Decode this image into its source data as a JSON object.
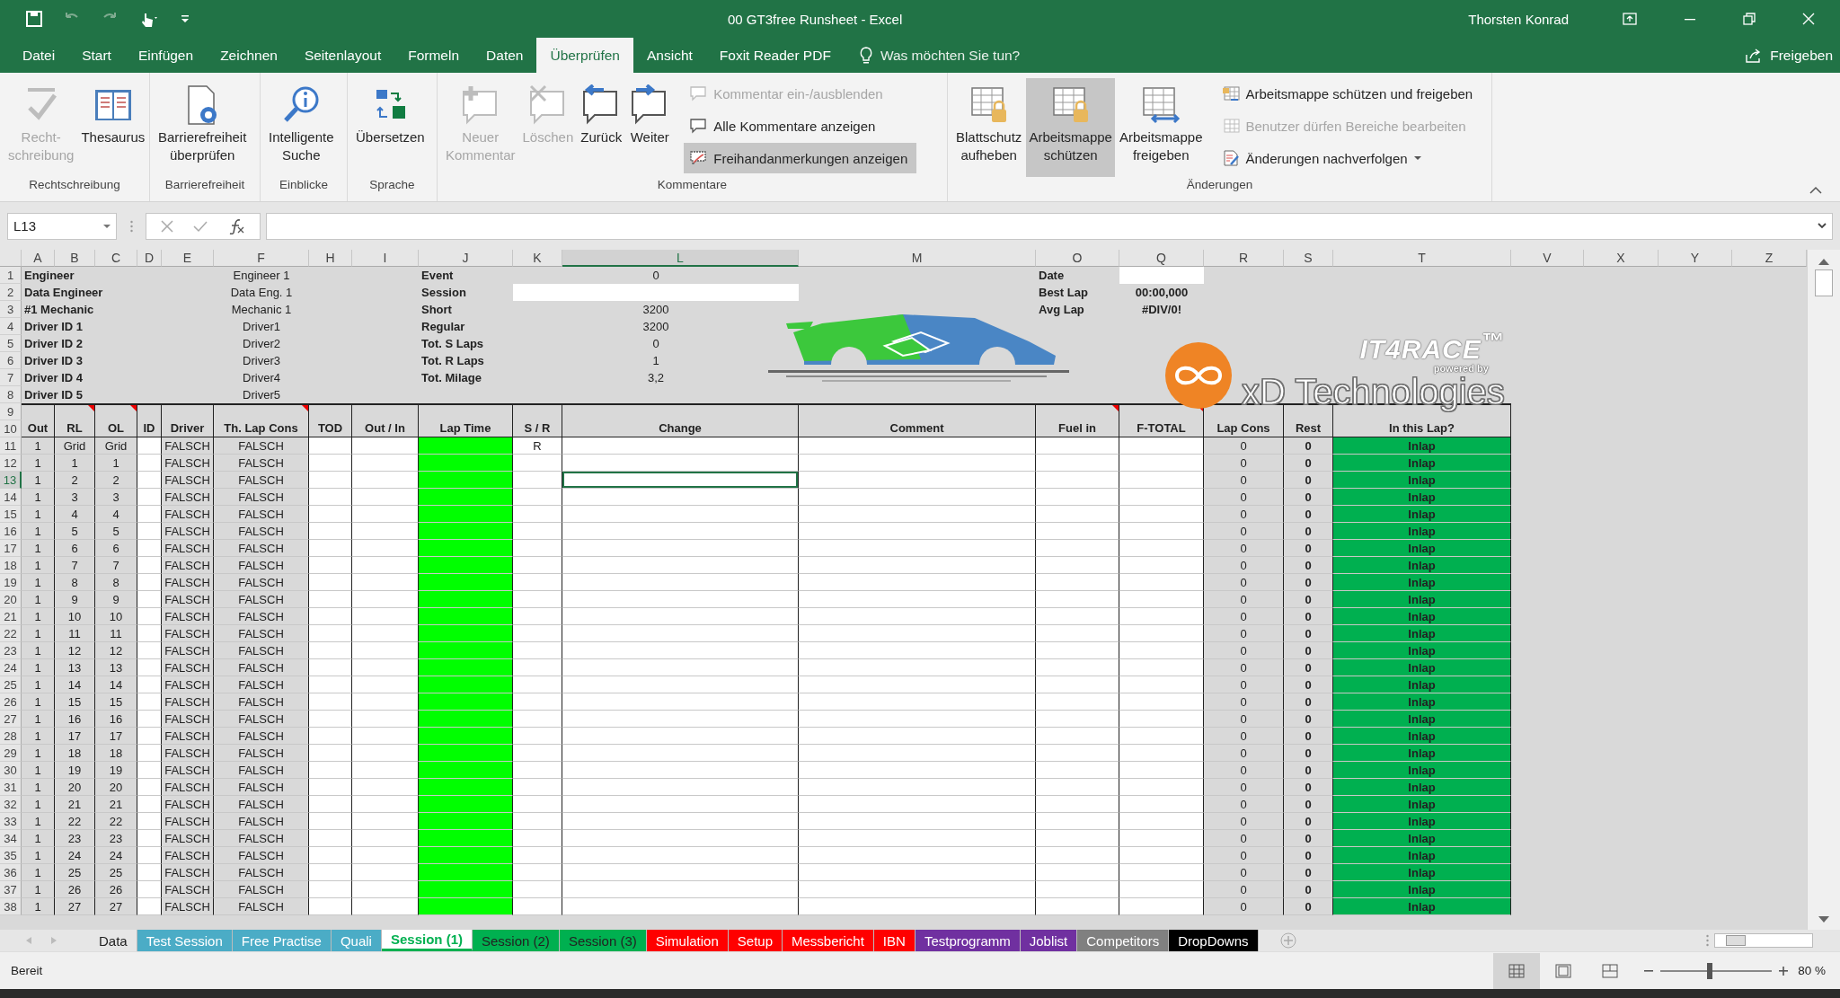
{
  "title_bar": {
    "title": "00 GT3free Runsheet  -  Excel",
    "user": "Thorsten Konrad",
    "quick_access": [
      {
        "disabled": false
      },
      {
        "disabled": true
      },
      {
        "disabled": true
      },
      {
        "disabled": false
      },
      {
        "disabled": false
      }
    ]
  },
  "menu_tabs": [
    {
      "label": "Datei",
      "selected": false
    },
    {
      "label": "Start",
      "selected": false
    },
    {
      "label": "Einfügen",
      "selected": false
    },
    {
      "label": "Zeichnen",
      "selected": false
    },
    {
      "label": "Seitenlayout",
      "selected": false
    },
    {
      "label": "Formeln",
      "selected": false
    },
    {
      "label": "Daten",
      "selected": false
    },
    {
      "label": "Überprüfen",
      "selected": true
    },
    {
      "label": "Ansicht",
      "selected": false
    },
    {
      "label": "Foxit Reader PDF",
      "selected": false
    }
  ],
  "tell_me": {
    "placeholder": "Was möchten Sie tun?"
  },
  "share_button": "Freigeben",
  "ribbon": {
    "groups": [
      {
        "label": "Rechtschreibung",
        "items": [
          {
            "kind": "large",
            "label": "Recht-\nschreibung",
            "disabled": true,
            "pressed": false
          },
          {
            "kind": "large",
            "label": "Thesaurus",
            "disabled": false,
            "pressed": false
          }
        ]
      },
      {
        "label": "Barrierefreiheit",
        "items": [
          {
            "kind": "large",
            "label": "Barrierefreiheit\nüberprüfen",
            "disabled": false,
            "pressed": false
          }
        ]
      },
      {
        "label": "Einblicke",
        "items": [
          {
            "kind": "large",
            "label": "Intelligente\nSuche",
            "disabled": false,
            "pressed": false
          }
        ]
      },
      {
        "label": "Sprache",
        "items": [
          {
            "kind": "large",
            "label": "Übersetzen",
            "disabled": false,
            "pressed": false
          }
        ]
      },
      {
        "label": "Kommentare",
        "items": [
          {
            "kind": "large",
            "label": "Neuer\nKommentar",
            "disabled": true,
            "pressed": false
          },
          {
            "kind": "large",
            "label": "Löschen",
            "disabled": true,
            "pressed": false
          },
          {
            "kind": "large",
            "label": "Zurück",
            "disabled": false,
            "pressed": false
          },
          {
            "kind": "large",
            "label": "Weiter",
            "disabled": false,
            "pressed": false
          },
          {
            "kind": "small",
            "label": "Kommentar ein-/ausblenden",
            "disabled": true,
            "pressed": false
          },
          {
            "kind": "small",
            "label": "Alle Kommentare anzeigen",
            "disabled": false,
            "pressed": false
          },
          {
            "kind": "small",
            "label": "Freihandanmerkungen anzeigen",
            "disabled": false,
            "pressed": true
          }
        ]
      },
      {
        "label": "Änderungen",
        "items": [
          {
            "kind": "large",
            "label": "Blattschutz\naufheben",
            "disabled": false,
            "pressed": false
          },
          {
            "kind": "large",
            "label": "Arbeitsmappe\nschützen",
            "disabled": false,
            "pressed": true
          },
          {
            "kind": "large",
            "label": "Arbeitsmappe\nfreigeben",
            "disabled": false,
            "pressed": false
          },
          {
            "kind": "small",
            "label": "Arbeitsmappe schützen und freigeben",
            "disabled": false,
            "pressed": false
          },
          {
            "kind": "small",
            "label": "Benutzer dürfen Bereiche bearbeiten",
            "disabled": true,
            "pressed": false
          },
          {
            "kind": "dropdown",
            "label": "Änderungen nachverfolgen",
            "disabled": false,
            "pressed": false
          }
        ]
      }
    ]
  },
  "formula_bar": {
    "name_box": "L13"
  },
  "sheet": {
    "column_letters": [
      {
        "letter": "A",
        "selected": false
      },
      {
        "letter": "B",
        "selected": false
      },
      {
        "letter": "C",
        "selected": false
      },
      {
        "letter": "D",
        "selected": false
      },
      {
        "letter": "E",
        "selected": false
      },
      {
        "letter": "F",
        "selected": false
      },
      {
        "letter": "H",
        "selected": false
      },
      {
        "letter": "I",
        "selected": false
      },
      {
        "letter": "J",
        "selected": false
      },
      {
        "letter": "K",
        "selected": false
      },
      {
        "letter": "L",
        "selected": true
      },
      {
        "letter": "M",
        "selected": false
      },
      {
        "letter": "O",
        "selected": false
      },
      {
        "letter": "Q",
        "selected": false
      },
      {
        "letter": "R",
        "selected": false
      },
      {
        "letter": "S",
        "selected": false
      },
      {
        "letter": "T",
        "selected": false
      },
      {
        "letter": "V",
        "selected": false
      },
      {
        "letter": "X",
        "selected": false
      },
      {
        "letter": "Y",
        "selected": false
      },
      {
        "letter": "Z",
        "selected": false
      }
    ],
    "info_rows": [
      {
        "row": "1",
        "crew_label": "Engineer",
        "crew_value": "Engineer 1",
        "session_label": "Event",
        "session_value": "0",
        "lap_label": "Date",
        "lap_field": true
      },
      {
        "row": "2",
        "crew_label": "Data Engineer",
        "crew_value": "Data Eng. 1",
        "session_label": "Session",
        "session_field": true,
        "lap_label": "Best Lap",
        "lap_value": "00:00,000"
      },
      {
        "row": "3",
        "crew_label": "#1 Mechanic",
        "crew_value": "Mechanic 1",
        "session_label": "Short",
        "session_value": "3200",
        "lap_label": "Avg Lap",
        "lap_value": "#DIV/0!"
      },
      {
        "row": "4",
        "crew_label": "Driver ID 1",
        "crew_value": "Driver1",
        "session_label": "Regular",
        "session_value": "3200"
      },
      {
        "row": "5",
        "crew_label": "Driver ID 2",
        "crew_value": "Driver2",
        "session_label": "Tot. S Laps",
        "session_value": "0"
      },
      {
        "row": "6",
        "crew_label": "Driver ID 3",
        "crew_value": "Driver3",
        "session_label": "Tot. R Laps",
        "session_value": "1"
      },
      {
        "row": "7",
        "crew_label": "Driver ID 4",
        "crew_value": "Driver4",
        "session_label": "Tot. Milage",
        "session_value": "3,2"
      },
      {
        "row": "8",
        "crew_label": "Driver ID 5",
        "crew_value": "Driver5"
      },
      {
        "row": "9"
      }
    ],
    "logo": {
      "brand": "IT4RACE$^{™}$",
      "tagline": "powered by",
      "company": "xD Technologies"
    },
    "table": {
      "header_rows": [
        "10"
      ],
      "columns": [
        {
          "label": "Out",
          "comment": false,
          "color": "#d9d9d9"
        },
        {
          "label": "RL",
          "comment": true,
          "color": "#d9d9d9"
        },
        {
          "label": "OL",
          "comment": true,
          "color": "#d9d9d9"
        },
        {
          "label": "ID",
          "comment": false,
          "color": "#ffffff"
        },
        {
          "label": "Driver",
          "comment": false,
          "color": "#d9d9d9"
        },
        {
          "label": "Th. Lap Cons",
          "comment": true,
          "color": "#d9d9d9"
        },
        {
          "label": "TOD",
          "comment": false,
          "color": "#ffffff"
        },
        {
          "label": "Out / In",
          "comment": false,
          "color": "#ffffff"
        },
        {
          "label": "Lap Time",
          "comment": false,
          "color": "#00ff00"
        },
        {
          "label": "S / R",
          "comment": false,
          "color": "#ffffff"
        },
        {
          "label": "Change",
          "comment": false,
          "color": "#ffffff"
        },
        {
          "label": "Comment",
          "comment": false,
          "color": "#ffffff"
        },
        {
          "label": "Fuel in",
          "comment": true,
          "color": "#ffffff"
        },
        {
          "label": "F-TOTAL",
          "comment": true,
          "color": "#ffffff"
        },
        {
          "label": "Lap Cons",
          "comment": false,
          "color": "#d9d9d9"
        },
        {
          "label": "Rest",
          "comment": false,
          "color": "#d9d9d9"
        },
        {
          "label": "In this Lap?",
          "comment": false,
          "color": "#00b050"
        }
      ],
      "rows": [
        {
          "row": "11",
          "selected": false,
          "out": "1",
          "rl": "Grid",
          "ol": "Grid",
          "driver": "FALSCH",
          "th_lap_cons": "FALSCH",
          "s_r": "R",
          "lap_cons": "0",
          "rest": "0",
          "in_this_lap": "Inlap"
        },
        {
          "row": "12",
          "selected": false,
          "out": "1",
          "rl": "1",
          "ol": "1",
          "driver": "FALSCH",
          "th_lap_cons": "FALSCH",
          "lap_cons": "0",
          "rest": "0",
          "in_this_lap": "Inlap"
        },
        {
          "row": "13",
          "selected": true,
          "out": "1",
          "rl": "2",
          "ol": "2",
          "driver": "FALSCH",
          "th_lap_cons": "FALSCH",
          "lap_cons": "0",
          "rest": "0",
          "in_this_lap": "Inlap"
        },
        {
          "row": "14",
          "selected": false,
          "out": "1",
          "rl": "3",
          "ol": "3",
          "driver": "FALSCH",
          "th_lap_cons": "FALSCH",
          "lap_cons": "0",
          "rest": "0",
          "in_this_lap": "Inlap"
        },
        {
          "row": "15",
          "selected": false,
          "out": "1",
          "rl": "4",
          "ol": "4",
          "driver": "FALSCH",
          "th_lap_cons": "FALSCH",
          "lap_cons": "0",
          "rest": "0",
          "in_this_lap": "Inlap"
        },
        {
          "row": "16",
          "selected": false,
          "out": "1",
          "rl": "5",
          "ol": "5",
          "driver": "FALSCH",
          "th_lap_cons": "FALSCH",
          "lap_cons": "0",
          "rest": "0",
          "in_this_lap": "Inlap"
        },
        {
          "row": "17",
          "selected": false,
          "out": "1",
          "rl": "6",
          "ol": "6",
          "driver": "FALSCH",
          "th_lap_cons": "FALSCH",
          "lap_cons": "0",
          "rest": "0",
          "in_this_lap": "Inlap"
        },
        {
          "row": "18",
          "selected": false,
          "out": "1",
          "rl": "7",
          "ol": "7",
          "driver": "FALSCH",
          "th_lap_cons": "FALSCH",
          "lap_cons": "0",
          "rest": "0",
          "in_this_lap": "Inlap"
        },
        {
          "row": "19",
          "selected": false,
          "out": "1",
          "rl": "8",
          "ol": "8",
          "driver": "FALSCH",
          "th_lap_cons": "FALSCH",
          "lap_cons": "0",
          "rest": "0",
          "in_this_lap": "Inlap"
        },
        {
          "row": "20",
          "selected": false,
          "out": "1",
          "rl": "9",
          "ol": "9",
          "driver": "FALSCH",
          "th_lap_cons": "FALSCH",
          "lap_cons": "0",
          "rest": "0",
          "in_this_lap": "Inlap"
        },
        {
          "row": "21",
          "selected": false,
          "out": "1",
          "rl": "10",
          "ol": "10",
          "driver": "FALSCH",
          "th_lap_cons": "FALSCH",
          "lap_cons": "0",
          "rest": "0",
          "in_this_lap": "Inlap"
        },
        {
          "row": "22",
          "selected": false,
          "out": "1",
          "rl": "11",
          "ol": "11",
          "driver": "FALSCH",
          "th_lap_cons": "FALSCH",
          "lap_cons": "0",
          "rest": "0",
          "in_this_lap": "Inlap"
        },
        {
          "row": "23",
          "selected": false,
          "out": "1",
          "rl": "12",
          "ol": "12",
          "driver": "FALSCH",
          "th_lap_cons": "FALSCH",
          "lap_cons": "0",
          "rest": "0",
          "in_this_lap": "Inlap"
        },
        {
          "row": "24",
          "selected": false,
          "out": "1",
          "rl": "13",
          "ol": "13",
          "driver": "FALSCH",
          "th_lap_cons": "FALSCH",
          "lap_cons": "0",
          "rest": "0",
          "in_this_lap": "Inlap"
        },
        {
          "row": "25",
          "selected": false,
          "out": "1",
          "rl": "14",
          "ol": "14",
          "driver": "FALSCH",
          "th_lap_cons": "FALSCH",
          "lap_cons": "0",
          "rest": "0",
          "in_this_lap": "Inlap"
        },
        {
          "row": "26",
          "selected": false,
          "out": "1",
          "rl": "15",
          "ol": "15",
          "driver": "FALSCH",
          "th_lap_cons": "FALSCH",
          "lap_cons": "0",
          "rest": "0",
          "in_this_lap": "Inlap"
        },
        {
          "row": "27",
          "selected": false,
          "out": "1",
          "rl": "16",
          "ol": "16",
          "driver": "FALSCH",
          "th_lap_cons": "FALSCH",
          "lap_cons": "0",
          "rest": "0",
          "in_this_lap": "Inlap"
        },
        {
          "row": "28",
          "selected": false,
          "out": "1",
          "rl": "17",
          "ol": "17",
          "driver": "FALSCH",
          "th_lap_cons": "FALSCH",
          "lap_cons": "0",
          "rest": "0",
          "in_this_lap": "Inlap"
        },
        {
          "row": "29",
          "selected": false,
          "out": "1",
          "rl": "18",
          "ol": "18",
          "driver": "FALSCH",
          "th_lap_cons": "FALSCH",
          "lap_cons": "0",
          "rest": "0",
          "in_this_lap": "Inlap"
        },
        {
          "row": "30",
          "selected": false,
          "out": "1",
          "rl": "19",
          "ol": "19",
          "driver": "FALSCH",
          "th_lap_cons": "FALSCH",
          "lap_cons": "0",
          "rest": "0",
          "in_this_lap": "Inlap"
        },
        {
          "row": "31",
          "selected": false,
          "out": "1",
          "rl": "20",
          "ol": "20",
          "driver": "FALSCH",
          "th_lap_cons": "FALSCH",
          "lap_cons": "0",
          "rest": "0",
          "in_this_lap": "Inlap"
        },
        {
          "row": "32",
          "selected": false,
          "out": "1",
          "rl": "21",
          "ol": "21",
          "driver": "FALSCH",
          "th_lap_cons": "FALSCH",
          "lap_cons": "0",
          "rest": "0",
          "in_this_lap": "Inlap"
        },
        {
          "row": "33",
          "selected": false,
          "out": "1",
          "rl": "22",
          "ol": "22",
          "driver": "FALSCH",
          "th_lap_cons": "FALSCH",
          "lap_cons": "0",
          "rest": "0",
          "in_this_lap": "Inlap"
        },
        {
          "row": "34",
          "selected": false,
          "out": "1",
          "rl": "23",
          "ol": "23",
          "driver": "FALSCH",
          "th_lap_cons": "FALSCH",
          "lap_cons": "0",
          "rest": "0",
          "in_this_lap": "Inlap"
        },
        {
          "row": "35",
          "selected": false,
          "out": "1",
          "rl": "24",
          "ol": "24",
          "driver": "FALSCH",
          "th_lap_cons": "FALSCH",
          "lap_cons": "0",
          "rest": "0",
          "in_this_lap": "Inlap"
        },
        {
          "row": "36",
          "selected": false,
          "out": "1",
          "rl": "25",
          "ol": "25",
          "driver": "FALSCH",
          "th_lap_cons": "FALSCH",
          "lap_cons": "0",
          "rest": "0",
          "in_this_lap": "Inlap"
        },
        {
          "row": "37",
          "selected": false,
          "out": "1",
          "rl": "26",
          "ol": "26",
          "driver": "FALSCH",
          "th_lap_cons": "FALSCH",
          "lap_cons": "0",
          "rest": "0",
          "in_this_lap": "Inlap"
        },
        {
          "row": "38",
          "selected": false,
          "out": "1",
          "rl": "27",
          "ol": "27",
          "driver": "FALSCH",
          "th_lap_cons": "FALSCH",
          "lap_cons": "0",
          "rest": "0",
          "in_this_lap": "Inlap"
        }
      ]
    }
  },
  "sheet_tabs": [
    {
      "label": "Data",
      "selected": false
    },
    {
      "label": "Test Session",
      "selected": false,
      "color": "#4bacc6"
    },
    {
      "label": "Free Practise",
      "selected": false,
      "color": "#4bacc6"
    },
    {
      "label": "Quali",
      "selected": false,
      "color": "#4bacc6"
    },
    {
      "label": "Session (1)",
      "selected": true,
      "color": "#00b050"
    },
    {
      "label": "Session (2)",
      "selected": false,
      "color": "#00b050"
    },
    {
      "label": "Session (3)",
      "selected": false,
      "color": "#00b050"
    },
    {
      "label": "Simulation",
      "selected": false,
      "color": "#ff0000"
    },
    {
      "label": "Setup",
      "selected": false,
      "color": "#ff0000"
    },
    {
      "label": "Messbericht",
      "selected": false,
      "color": "#ff0000"
    },
    {
      "label": "IBN",
      "selected": false,
      "color": "#ff0000"
    },
    {
      "label": "Testprogramm",
      "selected": false,
      "color": "#7030a0"
    },
    {
      "label": "Joblist",
      "selected": false,
      "color": "#7030a0"
    },
    {
      "label": "Competitors",
      "selected": false,
      "color": "#808080"
    },
    {
      "label": "DropDowns",
      "selected": false,
      "color": "#000000"
    }
  ],
  "status_bar": {
    "status": "Bereit",
    "views": [
      {
        "selected": true
      },
      {
        "selected": false
      },
      {
        "selected": false
      }
    ],
    "zoom": {
      "level": 0.44,
      "reading": "80 %"
    }
  }
}
